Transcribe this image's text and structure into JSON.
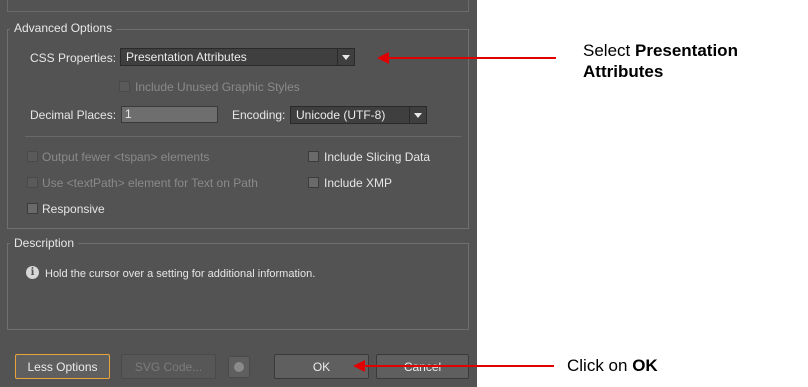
{
  "advanced_options": {
    "legend": "Advanced Options",
    "css_properties_label": "CSS Properties:",
    "css_properties_value": "Presentation Attributes",
    "include_unused_styles": "Include Unused Graphic Styles",
    "decimal_places_label": "Decimal Places:",
    "decimal_places_value": "1",
    "encoding_label": "Encoding:",
    "encoding_value": "Unicode (UTF-8)",
    "output_fewer_tspan": "Output fewer <tspan> elements",
    "use_textpath": "Use <textPath> element for Text on Path",
    "responsive": "Responsive",
    "include_slicing_data": "Include Slicing Data",
    "include_xmp": "Include XMP"
  },
  "description": {
    "legend": "Description",
    "text": "Hold the cursor over a setting for additional information."
  },
  "buttons": {
    "less_options": "Less Options",
    "svg_code": "SVG Code...",
    "ok": "OK",
    "cancel": "Cancel"
  },
  "annotations": {
    "select_prefix": "Select ",
    "select_bold": "Presentation Attributes",
    "click_prefix": "Click on ",
    "click_bold": "OK"
  },
  "colors": {
    "dialog_bg": "#535353",
    "annotation_arrow": "#e00000",
    "focus_border": "#e8a33c"
  },
  "icons": [
    "dropdown-arrow-icon",
    "info-icon",
    "globe-icon",
    "checkbox-icon"
  ]
}
